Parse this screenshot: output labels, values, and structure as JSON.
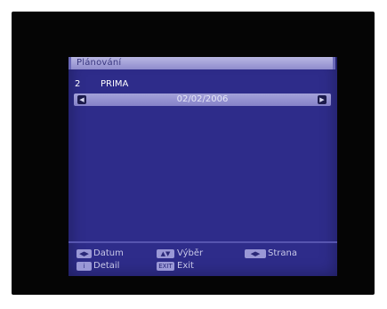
{
  "window": {
    "title": "Plánování"
  },
  "channel": {
    "number": "2",
    "name": "PRIMA"
  },
  "date_nav": {
    "date": "02/02/2006"
  },
  "legend": {
    "datum": "Datum",
    "vyber": "Výběr",
    "strana": "Strana",
    "detail": "Detail",
    "exit": "Exit",
    "exit_key": "EXIT"
  },
  "colors": {
    "screen_bg": "#2e2c8a",
    "title_bar": "#a8a6dc",
    "date_bar": "#9a98d4",
    "text": "#ffffff"
  },
  "icons": {
    "prev": "chevron-left-icon",
    "next": "chevron-right-icon",
    "datum_key": "left-right-arrows-icon",
    "vyber_key": "up-down-arrows-icon",
    "strana_key": "page-arrows-icon",
    "detail_key": "info-icon"
  }
}
